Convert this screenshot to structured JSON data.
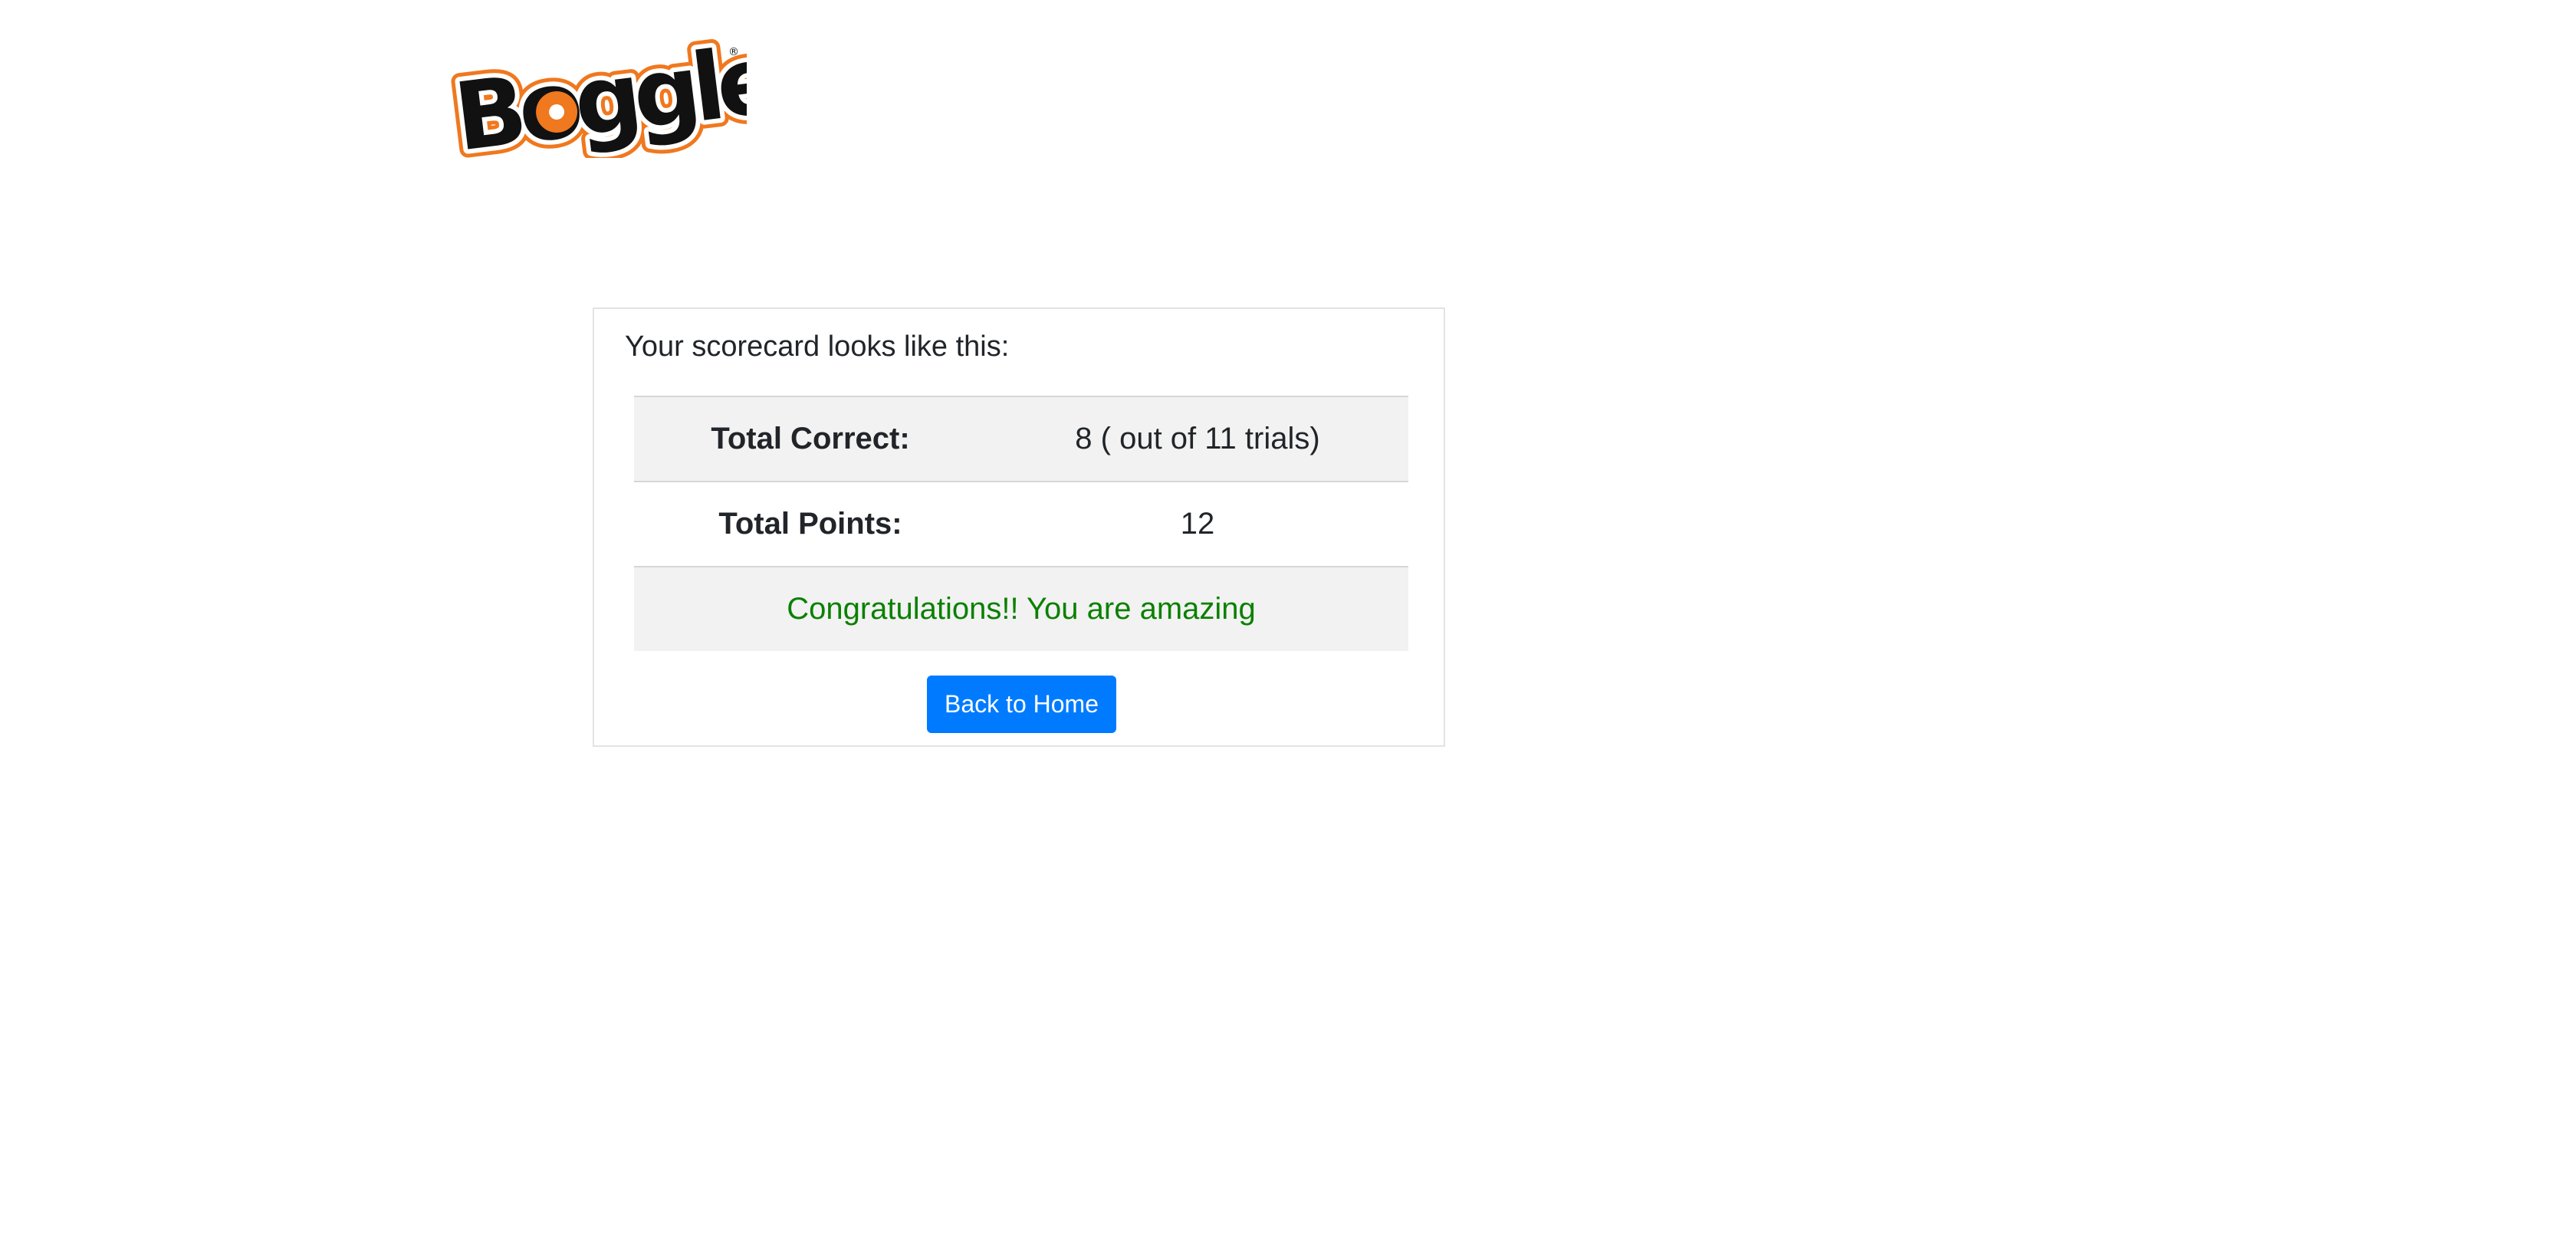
{
  "brand": {
    "logo_text": "Boggle",
    "trademark": "®",
    "colors": {
      "logo_fill": "#111111",
      "logo_outline": "#f0781e"
    }
  },
  "scorecard": {
    "intro": "Your scorecard looks like this:",
    "rows": [
      {
        "label": "Total Correct:",
        "value": "8 ( out of 11 trials)"
      },
      {
        "label": "Total Points:",
        "value": "12"
      }
    ],
    "message": "Congratulations!! You are amazing",
    "colors": {
      "message": "#0a8000",
      "stripe": "#f2f2f2",
      "button": "#007bff"
    }
  },
  "actions": {
    "back_home_label": "Back to Home"
  }
}
